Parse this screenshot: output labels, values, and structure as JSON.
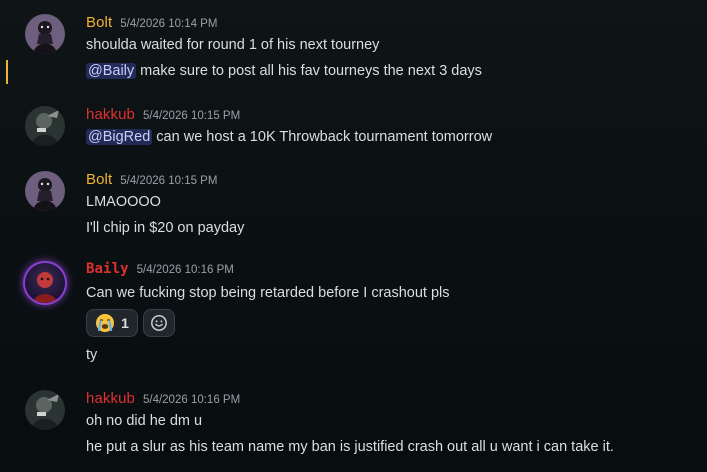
{
  "messages": [
    {
      "username": "Bolt",
      "username_color": "#f0b232",
      "timestamp": "5/4/2026 10:14 PM",
      "lines": [
        {
          "text": "shoulda waited for round 1 of his next tourney"
        },
        {
          "mention": "@Baily",
          "text": " make sure to post all his fav tourneys the next 3 days"
        }
      ]
    },
    {
      "username": "hakkub",
      "username_color": "#e02f2f",
      "timestamp": "5/4/2026 10:15 PM",
      "lines": [
        {
          "mention": "@BigRed",
          "text": " can we host a 10K Throwback tournament tomorrow"
        }
      ]
    },
    {
      "username": "Bolt",
      "username_color": "#f0b232",
      "timestamp": "5/4/2026 10:15 PM",
      "lines": [
        {
          "text": "LMAOOOO"
        },
        {
          "text": "I'll chip in $20 on payday"
        }
      ]
    },
    {
      "username": "Baily",
      "username_color": "#e02f2f",
      "timestamp": "5/4/2026 10:16 PM",
      "lines": [
        {
          "text": "Can we fucking stop being retarded before I crashout pls"
        },
        {
          "text": "ty"
        }
      ],
      "reactions": [
        {
          "emoji": "loudly-crying-face",
          "count": "1"
        },
        {
          "emoji": "add-reaction-icon"
        }
      ]
    },
    {
      "username": "hakkub",
      "username_color": "#e02f2f",
      "timestamp": "5/4/2026 10:16 PM",
      "lines": [
        {
          "text": "oh no did he dm u"
        },
        {
          "text": "he put a slur as his team name my ban is justified crash out all u want i can take it."
        }
      ]
    }
  ],
  "colors": {
    "mention_bg": "#3a4588",
    "highlight_bar": "#f0b232",
    "text": "#dbdee1",
    "timestamp": "#9aa0a6"
  }
}
